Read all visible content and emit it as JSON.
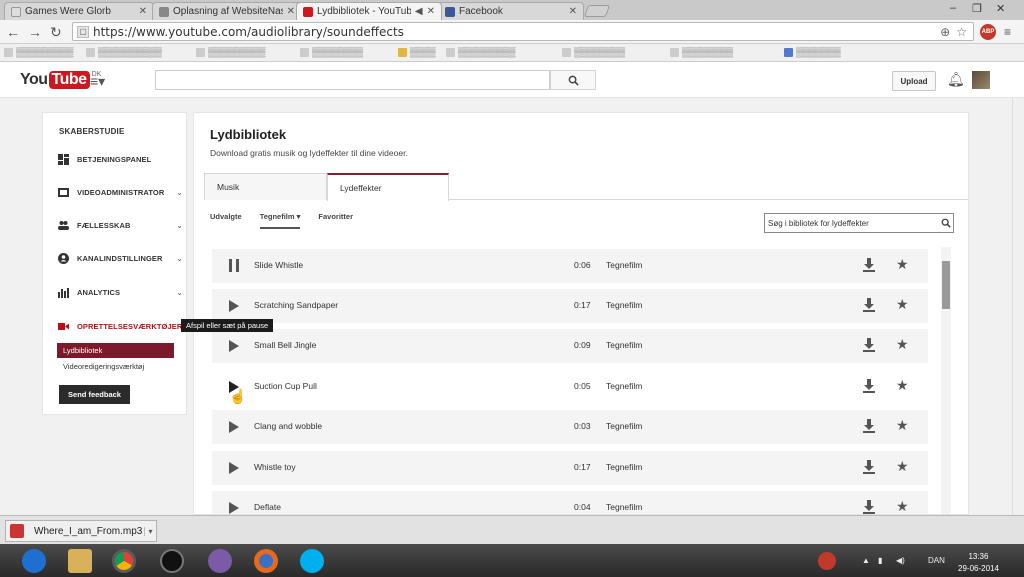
{
  "browser": {
    "tabs": [
      {
        "label": "Games Were Glorb"
      },
      {
        "label": "Oplasning af WebsiteNashe C"
      },
      {
        "label": "Lydbibliotek - YouTube"
      },
      {
        "label": "Facebook"
      }
    ],
    "url": "https://www.youtube.com/audiolibrary/soundeffects"
  },
  "youtube": {
    "logo_you": "You",
    "logo_tube": "Tube",
    "logo_region": "DK",
    "upload_label": "Upload"
  },
  "sidebar": {
    "title": "SKABERSTUDIE",
    "items": [
      {
        "label": "BETJENINGSPANEL"
      },
      {
        "label": "VIDEOADMINISTRATOR"
      },
      {
        "label": "FÆLLESSKAB"
      },
      {
        "label": "KANALINDSTILLINGER"
      },
      {
        "label": "ANALYTICS"
      },
      {
        "label": "OPRETTELSESVÆRKTØJER"
      }
    ],
    "subitems": [
      {
        "label": "Lydbibliotek"
      },
      {
        "label": "Videoredigeringsværktøj"
      }
    ],
    "feedback_label": "Send feedback"
  },
  "tooltip": "Afspil eller sæt på pause",
  "main": {
    "title": "Lydbibliotek",
    "subtitle": "Download gratis musik og lydeffekter til dine videoer.",
    "tabs": [
      {
        "label": "Musik"
      },
      {
        "label": "Lydeffekter"
      }
    ],
    "filters": [
      {
        "label": "Udvalgte"
      },
      {
        "label": "Tegnefilm ▾"
      },
      {
        "label": "Favoritter"
      }
    ],
    "search_placeholder": "Søg i bibliotek for lydeffekter",
    "rows": [
      {
        "name": "Slide Whistle",
        "duration": "0:06",
        "genre": "Tegnefilm"
      },
      {
        "name": "Scratching Sandpaper",
        "duration": "0:17",
        "genre": "Tegnefilm"
      },
      {
        "name": "Small Bell Jingle",
        "duration": "0:09",
        "genre": "Tegnefilm"
      },
      {
        "name": "Suction Cup Pull",
        "duration": "0:05",
        "genre": "Tegnefilm"
      },
      {
        "name": "Clang and wobble",
        "duration": "0:03",
        "genre": "Tegnefilm"
      },
      {
        "name": "Whistle toy",
        "duration": "0:17",
        "genre": "Tegnefilm"
      },
      {
        "name": "Deflate",
        "duration": "0:04",
        "genre": "Tegnefilm"
      }
    ]
  },
  "download": {
    "filename": "Where_I_am_From.mp3"
  },
  "taskbar": {
    "lang": "DAN",
    "time": "13:36",
    "date": "29-06-2014"
  },
  "colors": {
    "brand_red": "#cc181e",
    "accent": "#7b1a2a"
  }
}
